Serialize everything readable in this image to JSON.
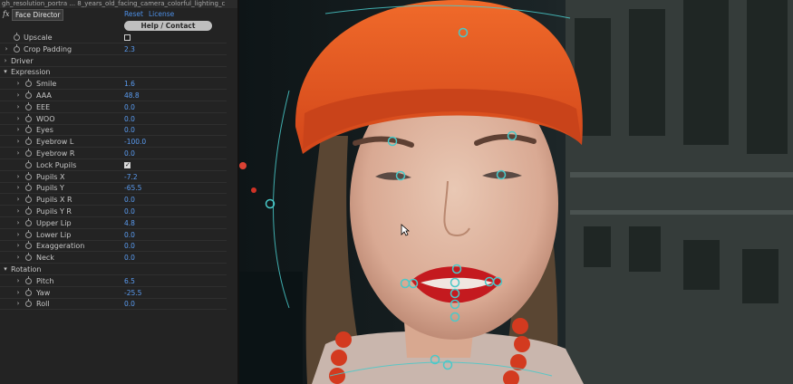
{
  "panel": {
    "layer_title": "gh_resolution_portra ... 8_years_old_facing_camera_colorful_lighting_c",
    "fx_glyph": "fx",
    "effect_name": "Face Director",
    "reset_label": "Reset",
    "license_label": "License",
    "help_label": "Help / Contact",
    "rows": [
      {
        "kind": "param",
        "label": "Upscale",
        "checkbox": false
      },
      {
        "kind": "param",
        "label": "Crop Padding",
        "value": "2.3",
        "expandable": true
      },
      {
        "kind": "group",
        "label": "Driver",
        "open": false
      },
      {
        "kind": "group",
        "label": "Expression",
        "open": true
      },
      {
        "kind": "sub",
        "label": "Smile",
        "value": "1.6"
      },
      {
        "kind": "sub",
        "label": "AAA",
        "value": "48.8"
      },
      {
        "kind": "sub",
        "label": "EEE",
        "value": "0.0"
      },
      {
        "kind": "sub",
        "label": "WOO",
        "value": "0.0"
      },
      {
        "kind": "sub",
        "label": "Eyes",
        "value": "0.0"
      },
      {
        "kind": "sub",
        "label": "Eyebrow L",
        "value": "-100.0"
      },
      {
        "kind": "sub",
        "label": "Eyebrow R",
        "value": "0.0"
      },
      {
        "kind": "sub",
        "label": "Lock Pupils",
        "checkbox": true,
        "noarrow": true
      },
      {
        "kind": "sub",
        "label": "Pupils X",
        "value": "-7.2"
      },
      {
        "kind": "sub",
        "label": "Pupils Y",
        "value": "-65.5"
      },
      {
        "kind": "sub",
        "label": "Pupils X R",
        "value": "0.0"
      },
      {
        "kind": "sub",
        "label": "Pupils Y R",
        "value": "0.0"
      },
      {
        "kind": "sub",
        "label": "Upper Lip",
        "value": "4.8"
      },
      {
        "kind": "sub",
        "label": "Lower Lip",
        "value": "0.0"
      },
      {
        "kind": "sub",
        "label": "Exaggeration",
        "value": "0.0"
      },
      {
        "kind": "sub",
        "label": "Neck",
        "value": "0.0"
      },
      {
        "kind": "group",
        "label": "Rotation",
        "open": true
      },
      {
        "kind": "sub",
        "label": "Pitch",
        "value": "6.5"
      },
      {
        "kind": "sub",
        "label": "Yaw",
        "value": "-25.5"
      },
      {
        "kind": "sub",
        "label": "Roll",
        "value": "0.0"
      }
    ]
  },
  "colors": {
    "link": "#4d8fe6",
    "value": "#5a9bf0",
    "handle": "#49c9c9",
    "hat": "#e0521d",
    "lips": "#c41a1f"
  },
  "icons": {
    "twirl": "chevron-icon",
    "stopwatch": "stopwatch-icon",
    "cursor": "arrow-cursor-icon"
  }
}
